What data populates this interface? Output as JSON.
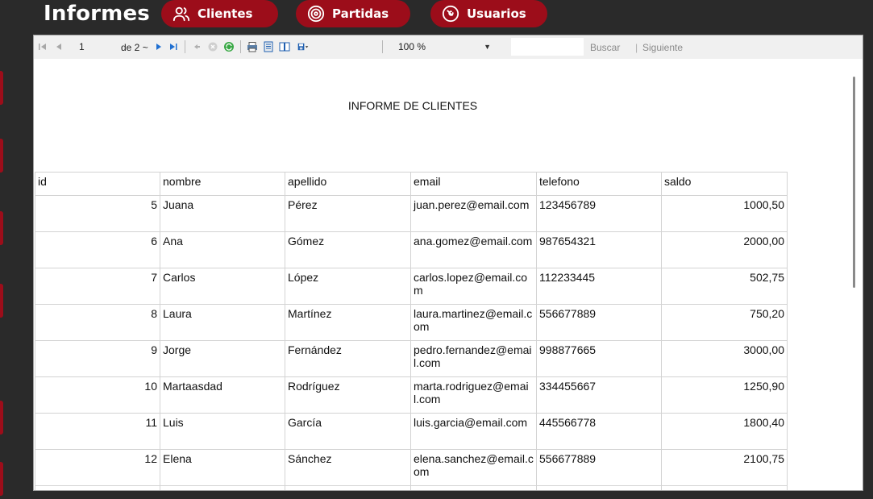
{
  "header": {
    "title": "Informes",
    "nav": [
      {
        "label": "Clientes",
        "icon": "users-icon"
      },
      {
        "label": "Partidas",
        "icon": "target-icon"
      },
      {
        "label": "Usuarios",
        "icon": "wrench-icon"
      }
    ],
    "accent_color": "#9c0d1a"
  },
  "toolbar": {
    "current_page": "1",
    "page_of": "de 2 ~",
    "zoom": "100 %",
    "search_placeholder": "",
    "find_label": "Buscar",
    "find_separator": "|",
    "next_label": "Siguiente"
  },
  "report": {
    "title": "INFORME DE CLIENTES",
    "columns": [
      "id",
      "nombre",
      "apellido",
      "email",
      "telefono",
      "saldo"
    ],
    "rows": [
      {
        "id": "5",
        "nombre": "Juana",
        "apellido": "Pérez",
        "email": "juan.perez@email.com",
        "telefono": "123456789",
        "saldo": "1000,50"
      },
      {
        "id": "6",
        "nombre": "Ana",
        "apellido": "Gómez",
        "email": "ana.gomez@email.com",
        "telefono": "987654321",
        "saldo": "2000,00"
      },
      {
        "id": "7",
        "nombre": "Carlos",
        "apellido": "López",
        "email": "carlos.lopez@email.com",
        "telefono": "112233445",
        "saldo": "502,75"
      },
      {
        "id": "8",
        "nombre": "Laura",
        "apellido": "Martínez",
        "email": "laura.martinez@email.com",
        "telefono": "556677889",
        "saldo": "750,20"
      },
      {
        "id": "9",
        "nombre": "Jorge",
        "apellido": "Fernández",
        "email": "pedro.fernandez@email.com",
        "telefono": "998877665",
        "saldo": "3000,00"
      },
      {
        "id": "10",
        "nombre": "Martaasdad",
        "apellido": "Rodríguez",
        "email": "marta.rodriguez@email.com",
        "telefono": "334455667",
        "saldo": "1250,90"
      },
      {
        "id": "11",
        "nombre": "Luis",
        "apellido": "García",
        "email": "luis.garcia@email.com",
        "telefono": "445566778",
        "saldo": "1800,40"
      },
      {
        "id": "12",
        "nombre": "Elena",
        "apellido": "Sánchez",
        "email": "elena.sanchez@email.com",
        "telefono": "556677889",
        "saldo": "2100,75"
      },
      {
        "id": "",
        "nombre": "",
        "apellido": "",
        "email": "",
        "telefono": "",
        "saldo": ""
      }
    ]
  }
}
